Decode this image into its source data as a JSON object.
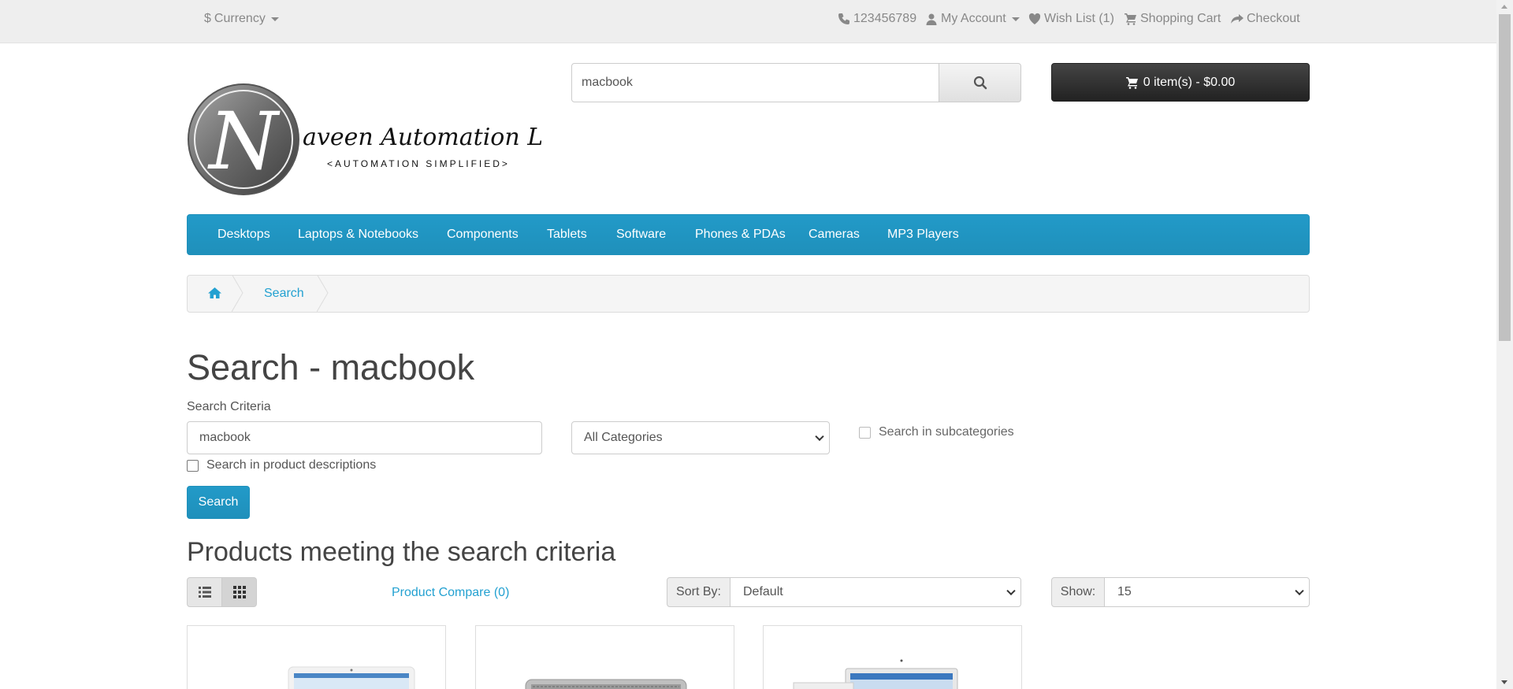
{
  "topbar": {
    "currency": "Currency",
    "phone": "123456789",
    "my_account": "My Account",
    "wish_list": "Wish List (1)",
    "shopping_cart": "Shopping Cart",
    "checkout": "Checkout"
  },
  "logo": {
    "letter": "N",
    "name": "aveen Automation Labs",
    "tagline": "<AUTOMATION SIMPLIFIED>"
  },
  "header": {
    "search_value": "macbook",
    "cart_label": "0 item(s) - $0.00"
  },
  "menu": [
    "Desktops",
    "Laptops & Notebooks",
    "Components",
    "Tablets",
    "Software",
    "Phones & PDAs",
    "Cameras",
    "MP3 Players"
  ],
  "breadcrumb": {
    "current": "Search"
  },
  "page": {
    "title": "Search - macbook",
    "criteria_label": "Search Criteria",
    "criteria_value": "macbook",
    "category_selected": "All Categories",
    "subcategories_label": "Search in subcategories",
    "descriptions_label": "Search in product descriptions",
    "search_button": "Search",
    "results_heading": "Products meeting the search criteria",
    "compare_link": "Product Compare (0)",
    "sort_label": "Sort By:",
    "sort_value": "Default",
    "show_label": "Show:",
    "show_value": "15"
  },
  "colors": {
    "accent": "#229ac8",
    "link": "#23a1d1",
    "topbar_bg": "#eeeeee",
    "cart_bg": "#333333"
  },
  "icons": [
    "currency-icon",
    "phone-icon",
    "user-icon",
    "heart-icon",
    "cart-icon",
    "share-icon",
    "search-icon",
    "home-icon",
    "list-view-icon",
    "grid-view-icon"
  ]
}
